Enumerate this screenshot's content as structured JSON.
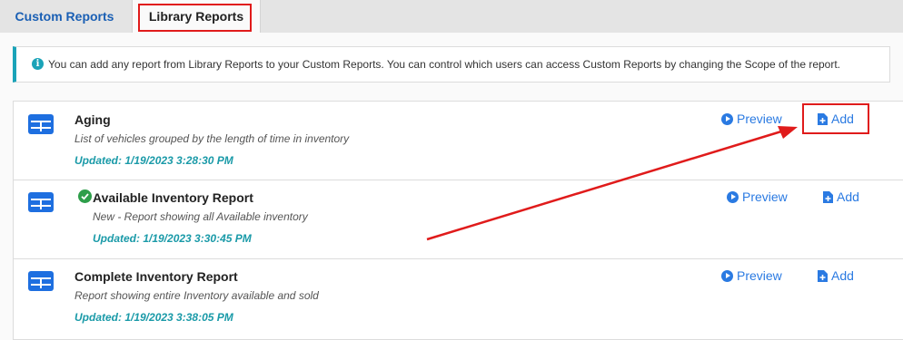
{
  "tabs": [
    {
      "label": "Custom Reports"
    },
    {
      "label": "Library Reports"
    }
  ],
  "info_banner": {
    "icon": "info-icon",
    "text": "You can add any report from Library Reports to your Custom Reports. You can control which users can access Custom Reports by changing the Scope of the report."
  },
  "reports": [
    {
      "title": "Aging",
      "description": "List of vehicles grouped by the length of time in inventory",
      "updated": "Updated:  1/19/2023 3:28:30 PM",
      "preview_label": "Preview",
      "add_label": "Add"
    },
    {
      "title": "Available Inventory Report",
      "description": "New - Report showing all Available inventory",
      "updated": "Updated:  1/19/2023 3:30:45 PM",
      "preview_label": "Preview",
      "add_label": "Add",
      "status_icon": "check-circle-icon"
    },
    {
      "title": "Complete Inventory Report",
      "description": "Report showing entire Inventory available and sold",
      "updated": "Updated:  1/19/2023 3:38:05 PM",
      "preview_label": "Preview",
      "add_label": "Add"
    }
  ],
  "colors": {
    "accent_blue": "#2a7ae2",
    "tab_blue": "#1a5fb4",
    "teal": "#1a9aa8",
    "icon_blue": "#1e6fe0",
    "success_green": "#2e9e4a",
    "annotation_red": "#e01b1b"
  }
}
